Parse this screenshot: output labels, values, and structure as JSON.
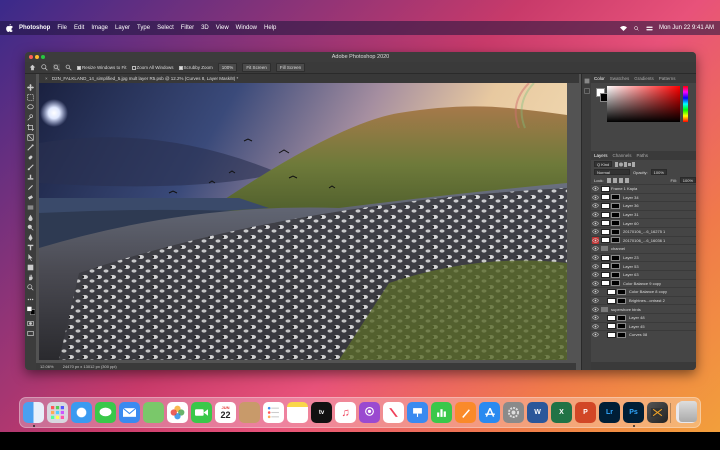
{
  "menubar": {
    "app_name": "Photoshop",
    "items": [
      "File",
      "Edit",
      "Image",
      "Layer",
      "Type",
      "Select",
      "Filter",
      "3D",
      "View",
      "Window",
      "Help"
    ],
    "datetime": "Mon Jun 22  9:41 AM"
  },
  "window": {
    "title": "Adobe Photoshop 2020",
    "document_tab": "D2N_FALKLAND_14_simplified_5.jpg mult layer R5.psb @ 12.2% (Curves 8, Layer Mask/8) *"
  },
  "options_bar": {
    "resize_windows": "Resize Windows to Fit",
    "zoom_all": "Zoom All Windows",
    "scrubby_zoom": "Scrubby Zoom",
    "zoom_value": "100%",
    "fit_screen": "Fit Screen",
    "fill_screen": "Fill Screen"
  },
  "status_bar": {
    "zoom": "12.06%",
    "doc_size": "24470 px x 13012 px (300 ppi)"
  },
  "panels": {
    "color_tabs": [
      "Color",
      "Swatches",
      "Gradients",
      "Patterns"
    ],
    "layer_tabs": [
      "Layers",
      "Channels",
      "Paths"
    ],
    "kind_label": "Q Kind",
    "blend_mode": "Normal",
    "opacity_label": "Opacity:",
    "opacity_value": "100%",
    "lock_label": "Lock:",
    "fill_label": "Fill:",
    "fill_value": "100%",
    "layers": [
      {
        "name": "Frame 1 Kapia",
        "type": "layer",
        "mask": false
      },
      {
        "name": "Layer 34",
        "type": "layer",
        "mask": true
      },
      {
        "name": "Layer 36",
        "type": "layer",
        "mask": true
      },
      {
        "name": "Layer 31",
        "type": "layer",
        "mask": true
      },
      {
        "name": "Layer 60",
        "type": "layer",
        "mask": true
      },
      {
        "name": "20170106_...6_16275 1",
        "type": "layer",
        "mask": true
      },
      {
        "name": "20170106_...6_16036 1",
        "type": "layer",
        "mask": true,
        "red": true
      },
      {
        "name": "channel",
        "type": "group",
        "mask": false
      },
      {
        "name": "Layer 23",
        "type": "layer",
        "mask": true
      },
      {
        "name": "Layer 53",
        "type": "layer",
        "mask": true
      },
      {
        "name": "Layer 63",
        "type": "layer",
        "mask": true
      },
      {
        "name": "Color Balance 9 copy",
        "type": "layer",
        "mask": true
      },
      {
        "name": "Color Balance 8 copy",
        "type": "layer",
        "mask": true,
        "indent": true
      },
      {
        "name": "Brightnes...ontrast 2",
        "type": "layer",
        "mask": true,
        "indent": true
      },
      {
        "name": "supershore birds",
        "type": "group",
        "mask": false
      },
      {
        "name": "Layer 48",
        "type": "layer",
        "mask": true,
        "indent": true
      },
      {
        "name": "Layer 45",
        "type": "layer",
        "mask": true,
        "indent": true
      },
      {
        "name": "Curves 08",
        "type": "layer",
        "mask": true,
        "indent": true
      }
    ]
  },
  "dock": {
    "calendar_month": "JUN",
    "calendar_day": "22",
    "apps": [
      "Finder",
      "Launchpad",
      "Safari",
      "Messages",
      "Mail",
      "Maps",
      "Photos",
      "FaceTime",
      "Calendar",
      "Contacts",
      "Reminders",
      "Notes",
      "TV",
      "Music",
      "Podcasts",
      "News",
      "Keynote",
      "Numbers",
      "Pages",
      "App Store",
      "System Preferences",
      "Word",
      "Excel",
      "PowerPoint",
      "Lightroom",
      "Photoshop",
      "Final Cut Pro",
      "Preview",
      "Trash"
    ]
  }
}
